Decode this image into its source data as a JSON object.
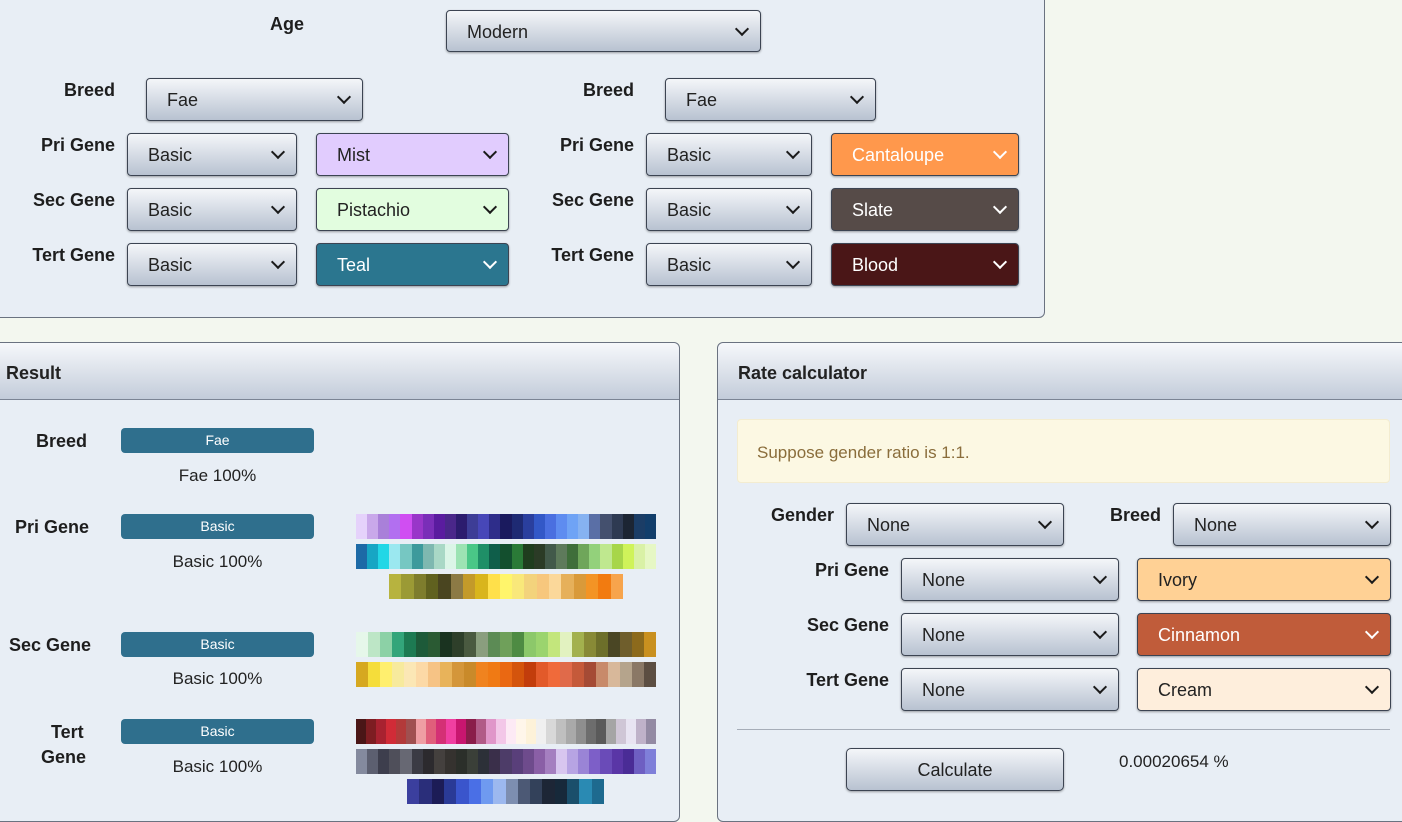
{
  "top": {
    "age_label": "Age",
    "age_value": "Modern",
    "breed_label": "Breed",
    "pri_label": "Pri Gene",
    "sec_label": "Sec Gene",
    "tert_label": "Tert Gene",
    "left": {
      "breed": "Fae",
      "pri_gene": "Basic",
      "pri_color": "Mist",
      "pri_hex": "#e1ccfe",
      "sec_gene": "Basic",
      "sec_color": "Pistachio",
      "sec_hex": "#e2fddf",
      "tert_gene": "Basic",
      "tert_color": "Teal",
      "tert_hex": "#2b768f"
    },
    "right": {
      "breed": "Fae",
      "pri_gene": "Basic",
      "pri_color": "Cantaloupe",
      "pri_hex": "#ff984c",
      "sec_gene": "Basic",
      "sec_color": "Slate",
      "sec_hex": "#564b48",
      "tert_gene": "Basic",
      "tert_color": "Blood",
      "tert_hex": "#4a1617"
    }
  },
  "result": {
    "title": "Result",
    "breed_label": "Breed",
    "breed_tag": "Fae",
    "breed_pct": "Fae 100%",
    "pri_label": "Pri Gene",
    "pri_tag": "Basic",
    "pri_pct": "Basic 100%",
    "sec_label": "Sec Gene",
    "sec_tag": "Basic",
    "sec_pct": "Basic 100%",
    "tert_label_1": "Tert",
    "tert_label_2": "Gene",
    "tert_tag": "Basic",
    "tert_pct": "Basic 100%",
    "pri_swatches": [
      [
        "#e5d2fb",
        "#c9a8ea",
        "#a980d9",
        "#b26ff0",
        "#d04ef2",
        "#9936c9",
        "#7a2eb8",
        "#5a1c9f",
        "#4a278a",
        "#2c1c6e",
        "#3d3d96",
        "#4747b8",
        "#2e2d8a",
        "#1a1a5e",
        "#1e2a73",
        "#2a3f9e",
        "#3358c7",
        "#4a6fe0",
        "#5e8cf0",
        "#6fa3f5",
        "#86b2f1",
        "#5a6fa6",
        "#44506e",
        "#2e3a52",
        "#1c2533",
        "#1b3d66",
        "#123e6b"
      ],
      [
        "#1d6aa6",
        "#17a6c4",
        "#22d7e6",
        "#9be8f0",
        "#76c7c2",
        "#3d9a9c",
        "#7eb8b0",
        "#a9d8c6",
        "#dbf5e7",
        "#9ce3b3",
        "#4ac787",
        "#1f8f67",
        "#0f5e4a",
        "#134f2e",
        "#2a7a37",
        "#1f3d1e",
        "#2b3b26",
        "#42594a",
        "#5e7a5b",
        "#3f6e3a",
        "#6fa65a",
        "#93d17b",
        "#bfe88f",
        "#a7d64a",
        "#cff35a",
        "#d9f1a6",
        "#e6f7c5"
      ],
      [
        "#b7b33f",
        "#9b9a35",
        "#7e7d2d",
        "#60611f",
        "#4a4520",
        "#8c7a45",
        "#c39a2a",
        "#d9b51c",
        "#ffe04a",
        "#fff56b",
        "#f9e87a",
        "#f3d37c",
        "#f7c77d",
        "#fbd89a",
        "#e6b05a",
        "#d99a3a",
        "#f39425",
        "#f27b10",
        "#f7a44c"
      ]
    ],
    "sec_swatches": [
      [
        "#e6f7ea",
        "#bde6c6",
        "#8cd1a6",
        "#33a57a",
        "#1d7a52",
        "#1d5a39",
        "#2a5a33",
        "#1a3320",
        "#2e3f2a",
        "#4a5a40",
        "#8a9e7e",
        "#5c8b55",
        "#6fa05a",
        "#4e8b43",
        "#8cc86a",
        "#9bd46e",
        "#c3e67c",
        "#e2f2c0",
        "#a3b14e",
        "#888a36",
        "#6d6f2a",
        "#4a4624",
        "#6f5e2c",
        "#8c6a1c",
        "#c9901f"
      ],
      [
        "#d6a820",
        "#f5dd3a",
        "#ffef6e",
        "#f7ea9d",
        "#fbe7b5",
        "#fcd9a6",
        "#f6c385",
        "#e8b35a",
        "#d4963a",
        "#c98a2a",
        "#f0831f",
        "#f07a14",
        "#ea6812",
        "#d4540c",
        "#c23d0c",
        "#e25a2a",
        "#f06a3a",
        "#e06a4a",
        "#c55a3a",
        "#a54b35",
        "#c88a6a",
        "#d8b89a",
        "#b5a48c",
        "#8a7866",
        "#5c4e42"
      ]
    ],
    "tert_swatches": [
      [
        "#4a1617",
        "#7d1d22",
        "#a82230",
        "#d12b37",
        "#b33a3a",
        "#a05050",
        "#ef9ea3",
        "#e05f7b",
        "#d43075",
        "#f03fa1",
        "#c8166f",
        "#8a1d4a",
        "#b15a87",
        "#e096c9",
        "#f3c7e8",
        "#fdeaf5",
        "#fff6ea",
        "#fdf2d9",
        "#f0f0f0",
        "#d8d8d8",
        "#bfbfbf",
        "#a9a9a9",
        "#8e8e8e",
        "#6d6d6d",
        "#5a5a5a",
        "#a5a5a5",
        "#cfc6d6",
        "#e8e4f2",
        "#bfb2c9",
        "#938aa3"
      ],
      [
        "#848a9e",
        "#5c5f70",
        "#3d3e4d",
        "#4f4f5a",
        "#676873",
        "#3b3b44",
        "#2c2a2e",
        "#44403e",
        "#35322f",
        "#2b2f2a",
        "#3a3f38",
        "#2c3038",
        "#3a2f4a",
        "#4d3c68",
        "#593f7a",
        "#6e4b8c",
        "#8a5fa6",
        "#a57fc0",
        "#d8c6ef",
        "#b7a4e3",
        "#9a84d6",
        "#7d5fc8",
        "#6a4bb8",
        "#5a36a6",
        "#4a2c96",
        "#6e5fc2",
        "#7f7fd9"
      ],
      [
        "#3b3f9e",
        "#2a2e7a",
        "#1c1c56",
        "#2a3a96",
        "#3a55cc",
        "#4a6fe6",
        "#6f9af0",
        "#9cb8ef",
        "#7d8eb0",
        "#4c5975",
        "#33415a",
        "#1d2636",
        "#17293a",
        "#1a4f6b",
        "#2a8ab3",
        "#1e6a8f"
      ]
    ]
  },
  "rate": {
    "title": "Rate calculator",
    "notice": "Suppose gender ratio is 1:1.",
    "gender_label": "Gender",
    "gender_value": "None",
    "breed_label": "Breed",
    "breed_value": "None",
    "pri_label": "Pri Gene",
    "pri_gene": "None",
    "pri_color": "Ivory",
    "pri_hex": "#ffd195",
    "sec_label": "Sec Gene",
    "sec_gene": "None",
    "sec_color": "Cinnamon",
    "sec_hex": "#c05c3a",
    "tert_label": "Tert Gene",
    "tert_gene": "None",
    "tert_color": "Cream",
    "tert_hex": "#feeedc",
    "calculate_label": "Calculate",
    "result_value": "0.00020654 %"
  }
}
